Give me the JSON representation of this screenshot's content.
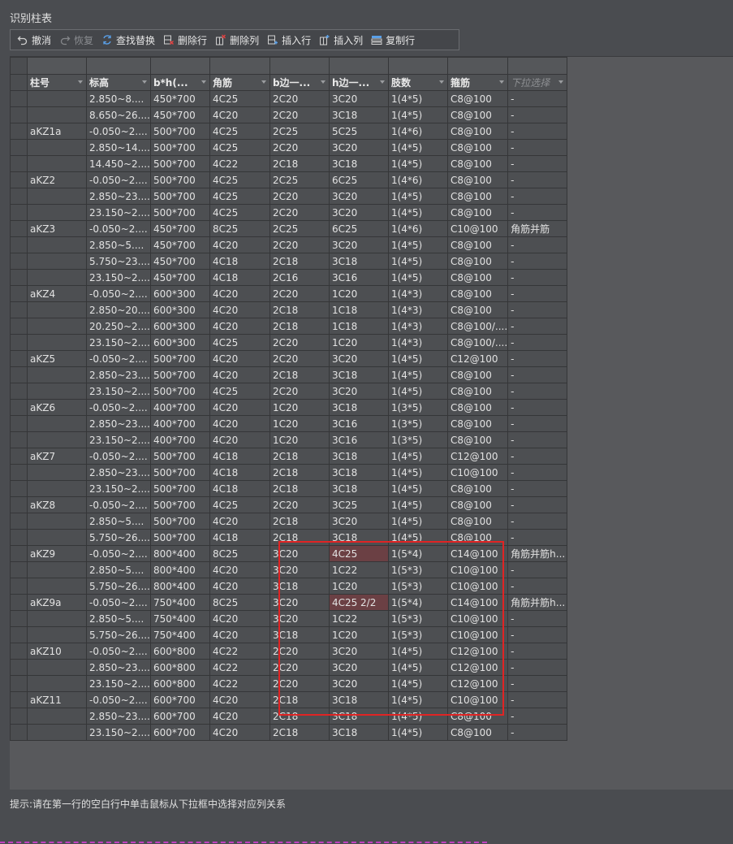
{
  "window": {
    "title": "识别柱表"
  },
  "toolbar": {
    "buttons": [
      {
        "label": "撤消",
        "icon": "undo-icon",
        "enabled": true
      },
      {
        "label": "恢复",
        "icon": "redo-icon",
        "enabled": false
      },
      {
        "label": "查找替换",
        "icon": "find-replace-icon",
        "enabled": true
      },
      {
        "label": "删除行",
        "icon": "delete-row-icon",
        "enabled": true
      },
      {
        "label": "删除列",
        "icon": "delete-column-icon",
        "enabled": true
      },
      {
        "label": "插入行",
        "icon": "insert-row-icon",
        "enabled": true
      },
      {
        "label": "插入列",
        "icon": "insert-column-icon",
        "enabled": true
      },
      {
        "label": "复制行",
        "icon": "copy-row-icon",
        "enabled": true
      }
    ]
  },
  "table": {
    "headers": [
      "柱号",
      "标高",
      "b*h(...",
      "角筋",
      "b边一...",
      "h边一...",
      "肢数",
      "箍筋",
      "下拉选择"
    ],
    "rows": [
      [
        "",
        "2.850~8....",
        "450*700",
        "4C25",
        "2C20",
        "3C20",
        "1(4*5)",
        "C8@100",
        "-"
      ],
      [
        "",
        "8.650~26....",
        "450*700",
        "4C20",
        "2C20",
        "3C18",
        "1(4*5)",
        "C8@100",
        "-"
      ],
      [
        "aKZ1a",
        "-0.050~2....",
        "500*700",
        "4C25",
        "2C25",
        "5C25",
        "1(4*6)",
        "C8@100",
        "-"
      ],
      [
        "",
        "2.850~14....",
        "500*700",
        "4C25",
        "2C20",
        "3C20",
        "1(4*5)",
        "C8@100",
        "-"
      ],
      [
        "",
        "14.450~2....",
        "500*700",
        "4C22",
        "2C18",
        "3C18",
        "1(4*5)",
        "C8@100",
        "-"
      ],
      [
        "aKZ2",
        "-0.050~2....",
        "500*700",
        "4C25",
        "2C25",
        "6C25",
        "1(4*6)",
        "C8@100",
        "-"
      ],
      [
        "",
        "2.850~23....",
        "500*700",
        "4C25",
        "2C20",
        "3C20",
        "1(4*5)",
        "C8@100",
        "-"
      ],
      [
        "",
        "23.150~2....",
        "500*700",
        "4C25",
        "2C20",
        "3C20",
        "1(4*5)",
        "C8@100",
        "-"
      ],
      [
        "aKZ3",
        "-0.050~2....",
        "450*700",
        "8C25",
        "2C25",
        "6C25",
        "1(4*6)",
        "C10@100",
        "角筋并筋"
      ],
      [
        "",
        "2.850~5....",
        "450*700",
        "4C20",
        "2C20",
        "3C20",
        "1(4*5)",
        "C8@100",
        "-"
      ],
      [
        "",
        "5.750~23....",
        "450*700",
        "4C18",
        "2C18",
        "3C18",
        "1(4*5)",
        "C8@100",
        "-"
      ],
      [
        "",
        "23.150~2....",
        "450*700",
        "4C18",
        "2C16",
        "3C16",
        "1(4*5)",
        "C8@100",
        "-"
      ],
      [
        "aKZ4",
        "-0.050~2....",
        "600*300",
        "4C20",
        "2C20",
        "1C20",
        "1(4*3)",
        "C8@100",
        "-"
      ],
      [
        "",
        "2.850~20....",
        "600*300",
        "4C20",
        "2C18",
        "1C18",
        "1(4*3)",
        "C8@100",
        "-"
      ],
      [
        "",
        "20.250~2....",
        "600*300",
        "4C20",
        "2C18",
        "1C18",
        "1(4*3)",
        "C8@100/....",
        "-"
      ],
      [
        "",
        "23.150~2....",
        "600*300",
        "4C25",
        "2C20",
        "1C20",
        "1(4*3)",
        "C8@100/....",
        "-"
      ],
      [
        "aKZ5",
        "-0.050~2....",
        "500*700",
        "4C20",
        "2C20",
        "3C20",
        "1(4*5)",
        "C12@100",
        "-"
      ],
      [
        "",
        "2.850~23....",
        "500*700",
        "4C20",
        "2C18",
        "3C18",
        "1(4*5)",
        "C8@100",
        "-"
      ],
      [
        "",
        "23.150~2....",
        "500*700",
        "4C25",
        "2C20",
        "3C20",
        "1(4*5)",
        "C8@100",
        "-"
      ],
      [
        "aKZ6",
        "-0.050~2....",
        "400*700",
        "4C20",
        "1C20",
        "3C18",
        "1(3*5)",
        "C8@100",
        "-"
      ],
      [
        "",
        "2.850~23....",
        "400*700",
        "4C20",
        "1C20",
        "3C16",
        "1(3*5)",
        "C8@100",
        "-"
      ],
      [
        "",
        "23.150~2....",
        "400*700",
        "4C20",
        "1C20",
        "3C16",
        "1(3*5)",
        "C8@100",
        "-"
      ],
      [
        "aKZ7",
        "-0.050~2....",
        "500*700",
        "4C18",
        "2C18",
        "3C18",
        "1(4*5)",
        "C12@100",
        "-"
      ],
      [
        "",
        "2.850~23....",
        "500*700",
        "4C18",
        "2C18",
        "3C18",
        "1(4*5)",
        "C10@100",
        "-"
      ],
      [
        "",
        "23.150~2....",
        "500*700",
        "4C18",
        "2C18",
        "3C18",
        "1(4*5)",
        "C8@100",
        "-"
      ],
      [
        "aKZ8",
        "-0.050~2....",
        "500*700",
        "4C25",
        "2C20",
        "3C25",
        "1(4*5)",
        "C8@100",
        "-"
      ],
      [
        "",
        "2.850~5....",
        "500*700",
        "4C20",
        "2C18",
        "3C20",
        "1(4*5)",
        "C8@100",
        "-"
      ],
      [
        "",
        "5.750~26....",
        "500*700",
        "4C18",
        "2C18",
        "3C18",
        "1(4*5)",
        "C8@100",
        "-"
      ],
      [
        "aKZ9",
        "-0.050~2....",
        "800*400",
        "8C25",
        "3C20",
        "4C25",
        "1(5*4)",
        "C14@100",
        "角筋并筋h..."
      ],
      [
        "",
        "2.850~5....",
        "800*400",
        "4C20",
        "3C20",
        "1C22",
        "1(5*3)",
        "C10@100",
        "-"
      ],
      [
        "",
        "5.750~26....",
        "800*400",
        "4C20",
        "3C18",
        "1C20",
        "1(5*3)",
        "C10@100",
        "-"
      ],
      [
        "aKZ9a",
        "-0.050~2....",
        "750*400",
        "8C25",
        "3C20",
        "4C25 2/2",
        "1(5*4)",
        "C14@100",
        "角筋并筋h..."
      ],
      [
        "",
        "2.850~5....",
        "750*400",
        "4C20",
        "3C20",
        "1C22",
        "1(5*3)",
        "C10@100",
        "-"
      ],
      [
        "",
        "5.750~26....",
        "750*400",
        "4C20",
        "3C18",
        "1C20",
        "1(5*3)",
        "C10@100",
        "-"
      ],
      [
        "aKZ10",
        "-0.050~2....",
        "600*800",
        "4C22",
        "2C20",
        "3C20",
        "1(4*5)",
        "C12@100",
        "-"
      ],
      [
        "",
        "2.850~23....",
        "600*800",
        "4C22",
        "2C20",
        "3C20",
        "1(4*5)",
        "C12@100",
        "-"
      ],
      [
        "",
        "23.150~2....",
        "600*800",
        "4C22",
        "2C20",
        "3C20",
        "1(4*5)",
        "C12@100",
        "-"
      ],
      [
        "aKZ11",
        "-0.050~2....",
        "600*700",
        "4C20",
        "2C18",
        "3C18",
        "1(4*5)",
        "C10@100",
        "-"
      ],
      [
        "",
        "2.850~23....",
        "600*700",
        "4C20",
        "2C18",
        "3C18",
        "1(4*5)",
        "C8@100",
        "-"
      ],
      [
        "",
        "23.150~2....",
        "600*700",
        "4C20",
        "2C18",
        "3C18",
        "1(4*5)",
        "C8@100",
        "-"
      ]
    ],
    "highlighted_cells": [
      [
        28,
        5
      ],
      [
        31,
        5
      ]
    ],
    "highlight_color": "#6b4044",
    "selection_color": "#e02424"
  },
  "status": {
    "hint": "提示:请在第一行的空白行中单击鼠标从下拉框中选择对应列关系"
  }
}
